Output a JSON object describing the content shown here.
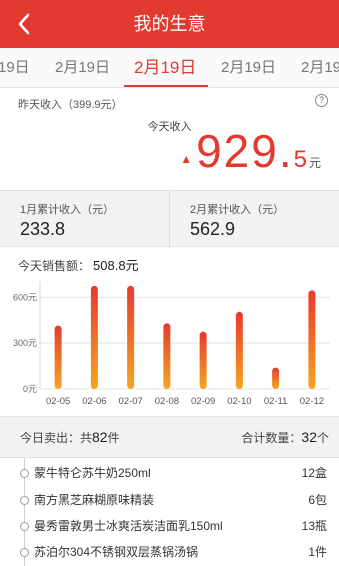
{
  "header": {
    "title": "我的生意",
    "back_icon": "chevron-left-icon"
  },
  "date_strip": {
    "items": [
      "19日",
      "2月19日",
      "2月19日",
      "2月19日",
      "2月19"
    ],
    "active_index": 2
  },
  "summary": {
    "yesterday_label": "昨天收入（399.9元）",
    "help_icon": "?",
    "today_label": "今天收入",
    "trend_icon": "▲",
    "today_integer": "929.",
    "today_decimal": "5",
    "today_unit": "元"
  },
  "monthly": {
    "jan_label": "1月累计收入（元）",
    "jan_value": "233.8",
    "feb_label": "2月累计收入（元）",
    "feb_value": "562.9"
  },
  "sales": {
    "label": "今天销售额：",
    "value": "508.8元"
  },
  "chart_data": {
    "type": "bar",
    "categories": [
      "02-05",
      "02-06",
      "02-07",
      "02-08",
      "02-09",
      "02-10",
      "02-11",
      "02-12"
    ],
    "values": [
      415,
      675,
      675,
      430,
      375,
      505,
      140,
      645
    ],
    "ylim": [
      0,
      700
    ],
    "yticks": [
      0,
      300,
      600
    ],
    "ytick_labels": [
      "0元",
      "300元",
      "600元"
    ],
    "grid": true,
    "bar_color_top": "#e8392d",
    "bar_color_bottom": "#f5a623"
  },
  "stats": {
    "sold_prefix": "今日卖出：共",
    "sold_count": "82",
    "sold_suffix": "件",
    "total_label": "合计数量：",
    "total_count": "32",
    "total_unit": "个"
  },
  "items": [
    {
      "name": "蒙牛特仑苏牛奶250ml",
      "qty": "12盒"
    },
    {
      "name": "南方黑芝麻糊原味精装",
      "qty": "6包"
    },
    {
      "name": "曼秀雷敦男士冰爽活炭洁面乳150ml",
      "qty": "13瓶"
    },
    {
      "name": "苏泊尔304不锈钢双层蒸锅汤锅",
      "qty": "1件"
    }
  ],
  "colors": {
    "accent": "#e23a30"
  }
}
